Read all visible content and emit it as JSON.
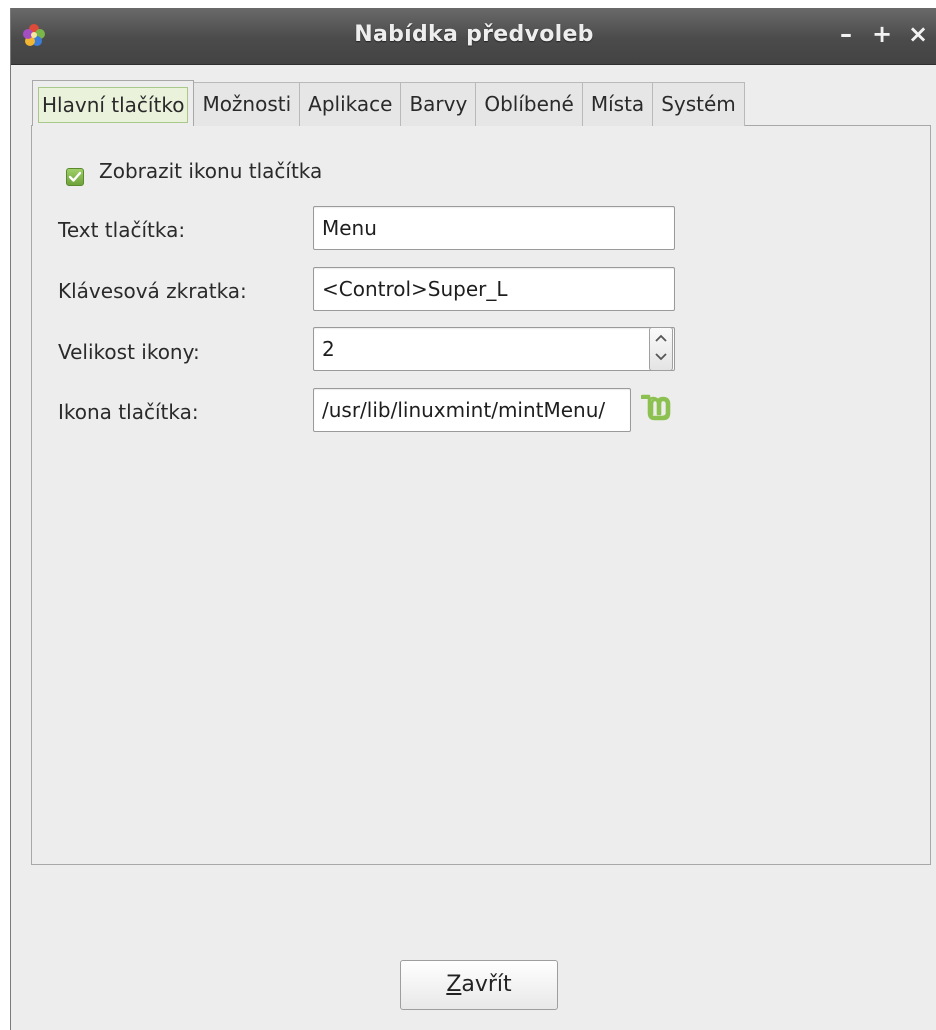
{
  "window": {
    "title": "Nabídka předvoleb",
    "controls": {
      "minimize": "–",
      "maximize": "+",
      "close": "×"
    },
    "app_icon": "mintmenu-flower-icon"
  },
  "tabs": [
    {
      "label": "Hlavní tlačítko",
      "active": true
    },
    {
      "label": "Možnosti",
      "active": false
    },
    {
      "label": "Aplikace",
      "active": false
    },
    {
      "label": "Barvy",
      "active": false
    },
    {
      "label": "Oblíbené",
      "active": false
    },
    {
      "label": "Místa",
      "active": false
    },
    {
      "label": "Systém",
      "active": false
    }
  ],
  "main": {
    "show_icon": {
      "label": "Zobrazit ikonu tlačítka",
      "checked": true
    },
    "button_text": {
      "label": "Text tlačítka:",
      "value": "Menu"
    },
    "shortcut": {
      "label": "Klávesová zkratka:",
      "value": "<Control>Super_L"
    },
    "icon_size": {
      "label": "Velikost ikony:",
      "value": "2"
    },
    "button_icon": {
      "label": "Ikona tlačítka:",
      "value": "/usr/lib/linuxmint/mintMenu/",
      "icon": "linux-mint-logo-icon"
    }
  },
  "footer": {
    "close_prefix": "Z",
    "close_rest": "avřít"
  },
  "colors": {
    "accent_green": "#8cc152",
    "titlebar": "#4b4b4b",
    "background": "#ededed"
  }
}
